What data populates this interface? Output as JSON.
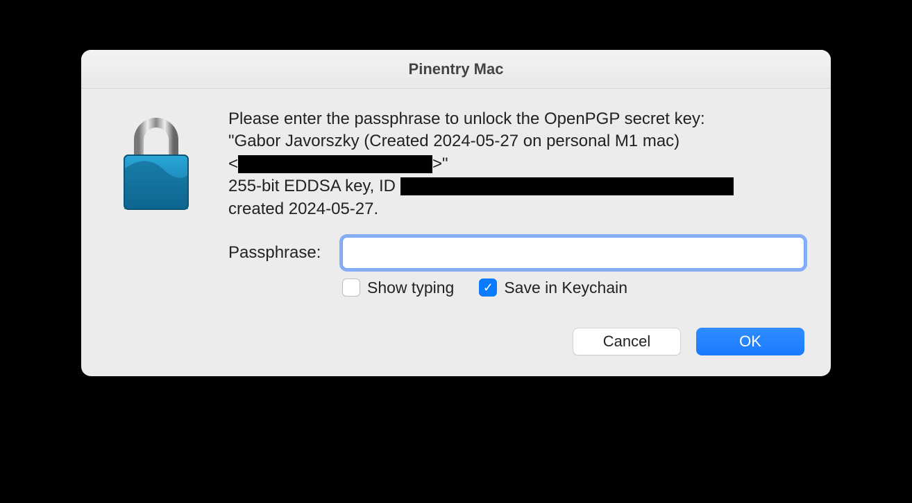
{
  "dialog": {
    "title": "Pinentry Mac",
    "prompt": {
      "line1": "Please enter the passphrase to unlock the OpenPGP secret key:",
      "line2a": "\"Gabor Javorszky (Created 2024-05-27 on personal M1 mac)",
      "line2b_prefix": "<",
      "line2b_suffix": ">\"",
      "line3_prefix": "255-bit EDDSA key, ID ",
      "line4": "created 2024-05-27."
    },
    "field": {
      "label": "Passphrase:",
      "value": ""
    },
    "options": {
      "show_typing": {
        "label": "Show typing",
        "checked": false
      },
      "save_keychain": {
        "label": "Save in Keychain",
        "checked": true
      }
    },
    "buttons": {
      "cancel": "Cancel",
      "ok": "OK"
    }
  }
}
